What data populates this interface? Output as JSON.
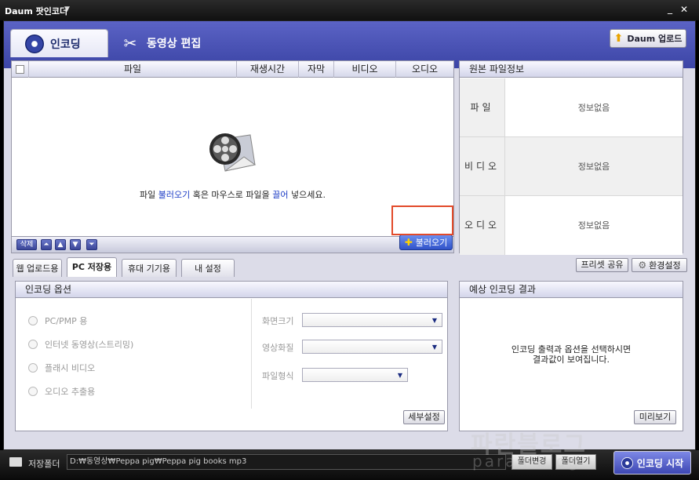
{
  "window": {
    "title": "Daum 팟인코더",
    "menu_icon": "chevron-down-icon"
  },
  "top_tabs": [
    {
      "label": "인코딩"
    },
    {
      "label": "동영상 편집"
    }
  ],
  "daum_upload": {
    "label": "Daum 업로드"
  },
  "file_list": {
    "columns": [
      "파일",
      "재생시간",
      "자막",
      "비디오",
      "오디오"
    ],
    "empty_hint": {
      "part1": "파일 ",
      "link1": "불러오기",
      "part2": " 혹은 마우스로 파일을 ",
      "link2": "끌어",
      "part3": " 넣으세요."
    },
    "toolbar": {
      "delete": "삭제",
      "top": "⏫",
      "up": "▲",
      "down": "▼",
      "bottom": "⏬"
    },
    "load_button": "불러오기"
  },
  "source_info": {
    "title": "원본 파일정보",
    "rows": [
      {
        "label": "파일",
        "value": "정보없음"
      },
      {
        "label": "비디오",
        "value": "정보없음"
      },
      {
        "label": "오디오",
        "value": "정보없음"
      }
    ]
  },
  "sub_tabs": [
    "웹 업로드용",
    "PC 저장용",
    "휴대 기기용",
    "내 설정"
  ],
  "preset_share": "프리셋 공유",
  "env_settings": "환경설정",
  "encoding_options": {
    "title": "인코딩 옵션",
    "radios": [
      "PC/PMP 용",
      "인터넷 동영상(스트리밍)",
      "플래시 비디오",
      "오디오 추출용"
    ],
    "fields": [
      {
        "label": "화면크기"
      },
      {
        "label": "영상화질"
      },
      {
        "label": "파일형식"
      }
    ],
    "detail_button": "세부설정"
  },
  "result": {
    "title": "예상 인코딩 결과",
    "line1": "인코딩 출력과 옵션을 선택하시면",
    "line2": "결과값이 보여집니다.",
    "preview_button": "미리보기"
  },
  "bottom": {
    "folder_label": "저장폴더",
    "path": "D:₩동영상₩Peppa pig₩Peppa pig books mp3",
    "change_folder": "폴더변경",
    "open_folder": "폴더열기",
    "start": "인코딩 시작"
  },
  "watermark": {
    "line1": "파란블로그",
    "line2": "paran blog"
  }
}
